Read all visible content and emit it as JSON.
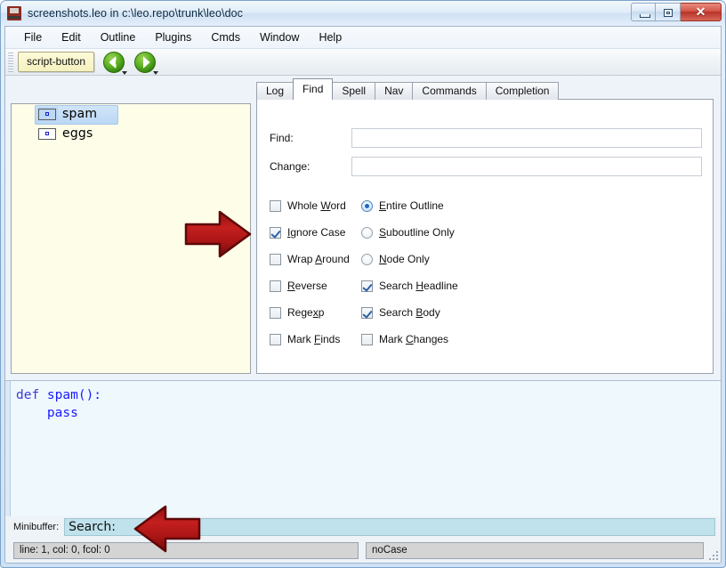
{
  "window": {
    "title": "screenshots.leo in c:\\leo.repo\\trunk\\leo\\doc",
    "app_icon": "leo-app-icon",
    "buttons": {
      "minimize": "minimize",
      "maximize": "maximize",
      "close": "close"
    }
  },
  "menubar": {
    "items": [
      {
        "label": "File"
      },
      {
        "label": "Edit"
      },
      {
        "label": "Outline"
      },
      {
        "label": "Plugins"
      },
      {
        "label": "Cmds"
      },
      {
        "label": "Window"
      },
      {
        "label": "Help"
      }
    ]
  },
  "toolbar": {
    "script_button_label": "script-button",
    "back_icon": "green-left-arrow-icon",
    "forward_icon": "green-right-arrow-icon",
    "accent_green": "#4a9e18"
  },
  "outline": {
    "nodes": [
      {
        "label": "spam",
        "selected": true
      },
      {
        "label": "eggs",
        "selected": false
      }
    ],
    "background": "#fdfde8"
  },
  "log_pane": {
    "tabs": [
      {
        "label": "Log",
        "active": false
      },
      {
        "label": "Find",
        "active": true
      },
      {
        "label": "Spell",
        "active": false
      },
      {
        "label": "Nav",
        "active": false
      },
      {
        "label": "Commands",
        "active": false
      },
      {
        "label": "Completion",
        "active": false
      }
    ]
  },
  "find_tab": {
    "find_label": "Find:",
    "find_value": "",
    "change_label": "Change:",
    "change_value": "",
    "checkboxes_left": [
      {
        "pre": "Whole ",
        "mnemonic": "W",
        "post": "ord",
        "checked": false,
        "name": "whole-word"
      },
      {
        "pre": "",
        "mnemonic": "I",
        "post": "gnore Case",
        "checked": true,
        "name": "ignore-case"
      },
      {
        "pre": "Wrap ",
        "mnemonic": "A",
        "post": "round",
        "checked": false,
        "name": "wrap-around"
      },
      {
        "pre": "",
        "mnemonic": "R",
        "post": "everse",
        "checked": false,
        "name": "reverse"
      },
      {
        "pre": "Rege",
        "mnemonic": "x",
        "post": "p",
        "checked": false,
        "name": "regexp"
      },
      {
        "pre": "Mark ",
        "mnemonic": "F",
        "post": "inds",
        "checked": false,
        "name": "mark-finds"
      }
    ],
    "right_column": [
      {
        "type": "radio",
        "pre": "",
        "mnemonic": "E",
        "post": "ntire Outline",
        "checked": true,
        "name": "entire-outline"
      },
      {
        "type": "radio",
        "pre": "",
        "mnemonic": "S",
        "post": "uboutline Only",
        "checked": false,
        "name": "suboutline-only"
      },
      {
        "type": "radio",
        "pre": "",
        "mnemonic": "N",
        "post": "ode Only",
        "checked": false,
        "name": "node-only"
      },
      {
        "type": "checkbox",
        "pre": "Search ",
        "mnemonic": "H",
        "post": "eadline",
        "checked": true,
        "name": "search-headline"
      },
      {
        "type": "checkbox",
        "pre": "Search ",
        "mnemonic": "B",
        "post": "ody",
        "checked": true,
        "name": "search-body"
      },
      {
        "type": "checkbox",
        "pre": "Mark ",
        "mnemonic": "C",
        "post": "hanges",
        "checked": false,
        "name": "mark-changes"
      }
    ]
  },
  "body_pane": {
    "line1_keyword": "def",
    "line1_rest": " spam():",
    "line2": "    pass"
  },
  "minibuffer": {
    "label": "Minibuffer:",
    "value": "Search:",
    "background": "#bfe2ec"
  },
  "statusbar": {
    "left": "line: 1, col: 0, fcol: 0",
    "right": "noCase"
  },
  "annotations": {
    "arrow_color_dark": "#7e0f0f",
    "arrow_color_light": "#d42020",
    "arrow_1": "points-at-wrap-around-checkbox",
    "arrow_2": "points-at-minibuffer-search-prompt"
  }
}
